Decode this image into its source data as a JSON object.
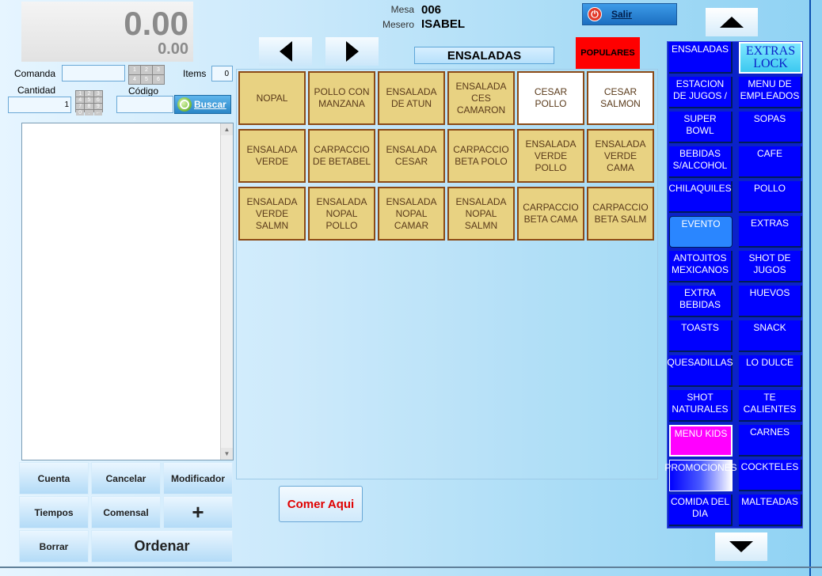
{
  "totals": {
    "main": "0.00",
    "sub": "0.00"
  },
  "order": {
    "comanda_label": "Comanda",
    "comanda_value": "",
    "items_label": "Items",
    "items_value": "0",
    "cantidad_label": "Cantidad",
    "cantidad_value": "1",
    "codigo_label": "Código",
    "codigo_value": "",
    "buscar_label": "Buscar"
  },
  "keypad_digits": [
    "1",
    "2",
    "3",
    "4",
    "5",
    "6"
  ],
  "keypad_small": [
    "1",
    "2",
    "3",
    "4",
    "5",
    "6",
    "7",
    "8",
    "9",
    "0",
    ".",
    "←"
  ],
  "header": {
    "mesa_label": "Mesa",
    "mesa_value": "006",
    "mesero_label": "Mesero",
    "mesero_value": "ISABEL",
    "salir_label": "Salir"
  },
  "category_title": "ENSALADAS",
  "populares_label": "POPULARES",
  "products": [
    {
      "label": "NOPAL",
      "style": "gold"
    },
    {
      "label": "POLLO CON MANZANA",
      "style": "gold"
    },
    {
      "label": "ENSALADA DE ATUN",
      "style": "gold"
    },
    {
      "label": "ENSALADA CES CAMARON",
      "style": "gold"
    },
    {
      "label": "CESAR POLLO",
      "style": "white"
    },
    {
      "label": "CESAR SALMON",
      "style": "white"
    },
    {
      "label": "ENSALADA VERDE",
      "style": "gold"
    },
    {
      "label": "CARPACCIO DE BETABEL",
      "style": "gold"
    },
    {
      "label": "ENSALADA CESAR",
      "style": "gold"
    },
    {
      "label": "CARPACCIO BETA POLO",
      "style": "gold"
    },
    {
      "label": "ENSALADA VERDE POLLO",
      "style": "gold"
    },
    {
      "label": "ENSALADA VERDE CAMA",
      "style": "gold"
    },
    {
      "label": "ENSALADA VERDE SALMN",
      "style": "gold"
    },
    {
      "label": "ENSALADA NOPAL POLLO",
      "style": "gold"
    },
    {
      "label": "ENSALADA NOPAL CAMAR",
      "style": "gold"
    },
    {
      "label": "ENSALADA NOPAL SALMN",
      "style": "gold"
    },
    {
      "label": "CARPACCIO BETA CAMA",
      "style": "gold"
    },
    {
      "label": "CARPACCIO BETA SALM",
      "style": "gold"
    }
  ],
  "actions": {
    "cuenta": "Cuenta",
    "cancelar": "Cancelar",
    "modificador": "Modificador",
    "tiempos": "Tiempos",
    "comensal": "Comensal",
    "plus": "+",
    "borrar": "Borrar",
    "ordenar": "Ordenar"
  },
  "comer_aqui_label": "Comer Aqui",
  "categories": [
    {
      "label": "ENSALADAS",
      "style": "normal"
    },
    {
      "label": "EXTRAS LOCK",
      "style": "lock"
    },
    {
      "label": "ESTACION DE JUGOS /",
      "style": "normal"
    },
    {
      "label": "MENU DE EMPLEADOS",
      "style": "normal"
    },
    {
      "label": "SUPER BOWL",
      "style": "normal"
    },
    {
      "label": "SOPAS",
      "style": "normal"
    },
    {
      "label": "BEBIDAS S/ALCOHOL",
      "style": "normal"
    },
    {
      "label": "CAFE",
      "style": "normal"
    },
    {
      "label": "CHILAQUILES",
      "style": "normal"
    },
    {
      "label": "POLLO",
      "style": "normal"
    },
    {
      "label": "EVENTO",
      "style": "evento"
    },
    {
      "label": "EXTRAS",
      "style": "normal"
    },
    {
      "label": "ANTOJITOS MEXICANOS",
      "style": "normal"
    },
    {
      "label": "SHOT DE JUGOS",
      "style": "normal"
    },
    {
      "label": "EXTRA BEBIDAS",
      "style": "normal"
    },
    {
      "label": "HUEVOS",
      "style": "normal"
    },
    {
      "label": "TOASTS",
      "style": "normal"
    },
    {
      "label": "SNACK",
      "style": "normal"
    },
    {
      "label": "QUESADILLAS",
      "style": "normal"
    },
    {
      "label": "LO DULCE",
      "style": "normal"
    },
    {
      "label": "SHOT NATURALES",
      "style": "normal"
    },
    {
      "label": "TE CALIENTES",
      "style": "normal"
    },
    {
      "label": "MENU KIDS",
      "style": "kids"
    },
    {
      "label": "CARNES",
      "style": "normal"
    },
    {
      "label": "PROMOCIONES",
      "style": "promo"
    },
    {
      "label": "COCKTELES",
      "style": "normal"
    },
    {
      "label": "COMIDA DEL DIA",
      "style": "normal"
    },
    {
      "label": "MALTEADAS",
      "style": "normal"
    }
  ],
  "colors": {
    "product_gold": "#e8d282",
    "product_border": "#8b4a16",
    "category_blue": "#0000ff",
    "populares_red": "#ff0000",
    "comer_aqui_text": "#e00000"
  }
}
